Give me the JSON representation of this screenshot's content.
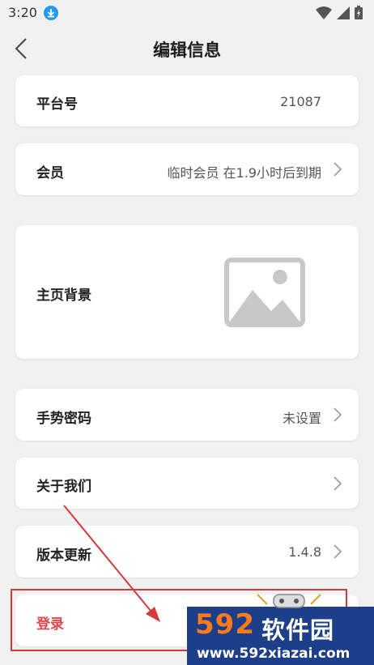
{
  "status": {
    "time": "3:20"
  },
  "header": {
    "title": "编辑信息"
  },
  "rows": {
    "platform": {
      "label": "平台号",
      "value": "21087"
    },
    "member": {
      "label": "会员",
      "value": "临时会员 在1.9小时后到期"
    },
    "background": {
      "label": "主页背景"
    },
    "gesture": {
      "label": "手势密码",
      "value": "未设置"
    },
    "about": {
      "label": "关于我们"
    },
    "version": {
      "label": "版本更新",
      "value": "1.4.8"
    },
    "login": {
      "label": "登录"
    }
  },
  "watermark": {
    "logo": "592",
    "logo_cn": "软件园",
    "url": "www.592xiazai.com"
  },
  "colors": {
    "background": "#f1f1f1",
    "login_red": "#e0474c",
    "annotation_red": "#d23a3a",
    "watermark_blue": "#1d3f8a",
    "watermark_orange": "#ff7a1a"
  }
}
